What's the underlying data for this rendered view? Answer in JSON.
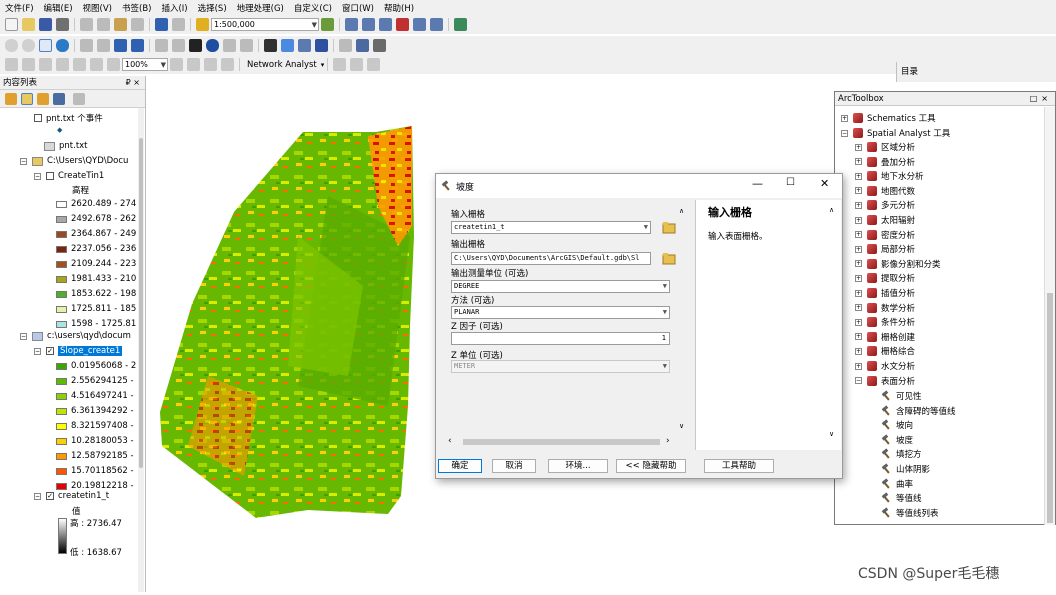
{
  "menubar": {
    "items": [
      "文件(F)",
      "编辑(E)",
      "视图(V)",
      "书签(B)",
      "插入(I)",
      "选择(S)",
      "地理处理(G)",
      "自定义(C)",
      "窗口(W)",
      "帮助(H)"
    ]
  },
  "toolbar": {
    "scale": "1:500,000",
    "zoom": "100%",
    "network_analyst": "Network Analyst"
  },
  "toc": {
    "title": "内容列表",
    "pin": "₽ ×",
    "items": {
      "pnt_event": "pnt.txt 个事件",
      "pnt_txt": "pnt.txt",
      "folder1": "C:\\Users\\QYD\\Docu",
      "createtin": "CreateTin1",
      "elev_label": "高程",
      "tin_classes": [
        {
          "label": "2620.489 - 274",
          "color": "#ffffff"
        },
        {
          "label": "2492.678 - 262",
          "color": "#a8a8a8"
        },
        {
          "label": "2364.867 - 249",
          "color": "#9a4a1e"
        },
        {
          "label": "2237.056 - 236",
          "color": "#7a2410"
        },
        {
          "label": "2109.244 - 223",
          "color": "#a4501c"
        },
        {
          "label": "1981.433 - 210",
          "color": "#a8a41c"
        },
        {
          "label": "1853.622 - 198",
          "color": "#4fae2a"
        },
        {
          "label": "1725.811 - 185",
          "color": "#e6f2a8"
        },
        {
          "label": "1598 - 1725.81",
          "color": "#a8e4e4"
        }
      ],
      "folder2": "c:\\users\\qyd\\docum",
      "slope_layer": "Slope_create1",
      "slope_classes": [
        {
          "label": "0.01956068 - 2",
          "color": "#38a800"
        },
        {
          "label": "2.556294125 -",
          "color": "#5cbd00"
        },
        {
          "label": "4.516497241 -",
          "color": "#8ad300"
        },
        {
          "label": "6.361394292 -",
          "color": "#bae600"
        },
        {
          "label": "8.321597408 -",
          "color": "#ffff00"
        },
        {
          "label": "10.28180053 -",
          "color": "#ffd000"
        },
        {
          "label": "12.58792185 -",
          "color": "#ff9900"
        },
        {
          "label": "15.70118562 -",
          "color": "#ff5500"
        },
        {
          "label": "20.19812218 -",
          "color": "#e60000"
        }
      ],
      "createtin1_t": "createtin1_t",
      "value_label": "值",
      "high": "高 : 2736.47",
      "low": "低 : 1638.67"
    }
  },
  "catalog": {
    "title": "目录"
  },
  "toolbox": {
    "title": "ArcToolbox",
    "controls": "□×",
    "schematics": "Schematics 工具",
    "spatial_analyst": "Spatial Analyst 工具",
    "sets": [
      "区域分析",
      "叠加分析",
      "地下水分析",
      "地图代数",
      "多元分析",
      "太阳辐射",
      "密度分析",
      "局部分析",
      "影像分割和分类",
      "提取分析",
      "插值分析",
      "数学分析",
      "条件分析",
      "栅格创建",
      "栅格综合",
      "水文分析",
      "表面分析"
    ],
    "surface_tools": [
      "可见性",
      "含障碍的等值线",
      "坡向",
      "坡度",
      "填挖方",
      "山体阴影",
      "曲率",
      "等值线",
      "等值线列表"
    ]
  },
  "dialog": {
    "title": "坡度",
    "input_label": "输入栅格",
    "input_value": "createtin1_t",
    "output_label": "输出栅格",
    "output_value": "C:\\Users\\QYD\\Documents\\ArcGIS\\Default.gdb\\Sl",
    "unit_label": "输出测量单位 (可选)",
    "unit_value": "DEGREE",
    "method_label": "方法 (可选)",
    "method_value": "PLANAR",
    "zfactor_label": "Z 因子 (可选)",
    "zfactor_value": "1",
    "zunit_label": "Z 单位 (可选)",
    "zunit_value": "METER",
    "help_title": "输入栅格",
    "help_text": "输入表面栅格。",
    "buttons": {
      "ok": "确定",
      "cancel": "取消",
      "env": "环境...",
      "hide_help": "<< 隐藏帮助",
      "tool_help": "工具帮助"
    }
  },
  "watermark": "CSDN @Super毛毛穗"
}
